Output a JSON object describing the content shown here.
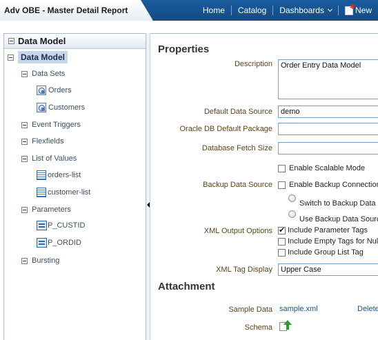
{
  "header": {
    "title": "Adv OBE - Master Detail Report",
    "nav": {
      "home": "Home",
      "catalog": "Catalog",
      "dashboards": "Dashboards",
      "new": "New"
    }
  },
  "left_panel": {
    "title": "Data Model",
    "root": "Data Model",
    "data_sets": {
      "label": "Data Sets",
      "items": [
        "Orders",
        "Customers"
      ]
    },
    "event_triggers": "Event Triggers",
    "flexfields": "Flexfields",
    "list_of_values": {
      "label": "List of Values",
      "items": [
        "orders-list",
        "customer-list"
      ]
    },
    "parameters": {
      "label": "Parameters",
      "items": [
        "P_CUSTID",
        "P_ORDID"
      ]
    },
    "bursting": "Bursting"
  },
  "properties": {
    "title": "Properties",
    "description_label": "Description",
    "description_value": "Order Entry Data  Model",
    "default_data_source_label": "Default Data Source",
    "default_data_source_value": "demo",
    "oracle_pkg_label": "Oracle DB Default Package",
    "oracle_pkg_value": "",
    "fetch_size_label": "Database Fetch Size",
    "fetch_size_value": "",
    "enable_scalable_mode": {
      "label": "Enable Scalable Mode",
      "checked": false
    },
    "backup_label": "Backup Data Source",
    "enable_backup": {
      "label": "Enable Backup Connection",
      "checked": false
    },
    "switch_backup": "Switch to Backup Data",
    "use_backup": "Use Backup Data Source",
    "xml_output_label": "XML Output Options",
    "include_param_tags": {
      "label": "Include Parameter Tags",
      "checked": true
    },
    "include_empty_tags": {
      "label": "Include Empty Tags for Null",
      "checked": false
    },
    "include_group_list": {
      "label": "Include Group List Tag",
      "checked": false
    },
    "xml_tag_display_label": "XML Tag Display",
    "xml_tag_display_value": "Upper Case"
  },
  "attachment": {
    "title": "Attachment",
    "sample_data_label": "Sample Data",
    "sample_data_link": "sample.xml",
    "delete_link": "Delete",
    "schema_label": "Schema"
  },
  "colors": {
    "header_blue": "#1a5c9e",
    "label_brown": "#5a4418",
    "link_blue": "#1e4f8c",
    "selection": "#c7d6eb"
  },
  "icons": {
    "data_set": "data-set-icon",
    "lov": "list-of-values-icon",
    "parameter": "parameter-icon",
    "schema_upload": "upload-icon",
    "new": "new-document-icon"
  }
}
